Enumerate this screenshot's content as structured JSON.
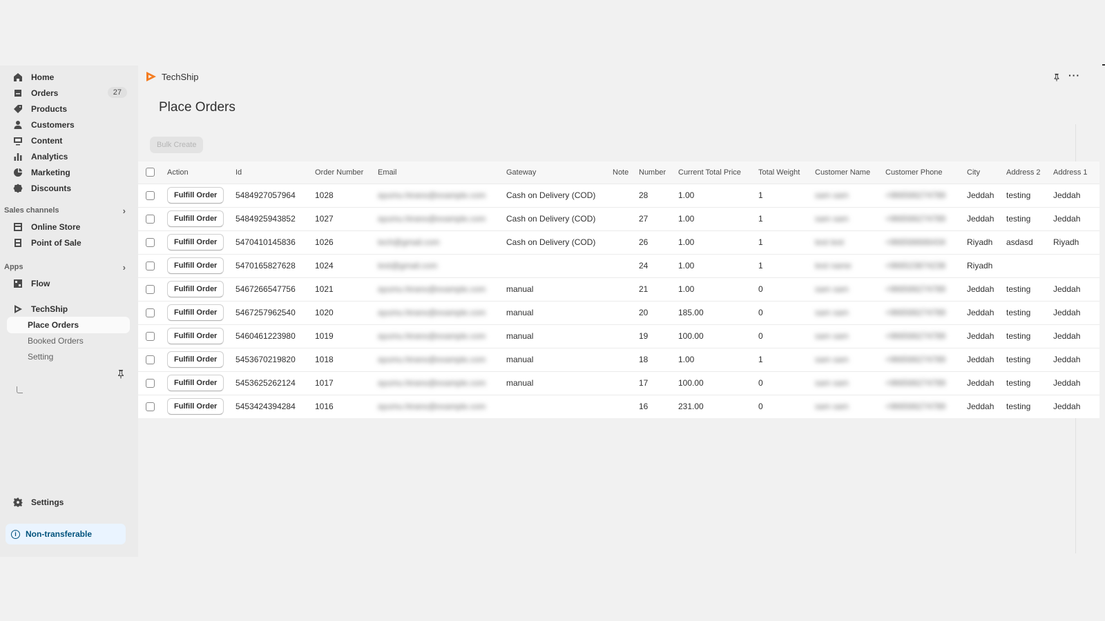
{
  "sidebar": {
    "nav": [
      {
        "label": "Home",
        "icon": "home-icon"
      },
      {
        "label": "Orders",
        "icon": "orders-icon",
        "badge": "27"
      },
      {
        "label": "Products",
        "icon": "tag-icon"
      },
      {
        "label": "Customers",
        "icon": "person-icon"
      },
      {
        "label": "Content",
        "icon": "content-icon"
      },
      {
        "label": "Analytics",
        "icon": "bar-chart-icon"
      },
      {
        "label": "Marketing",
        "icon": "marketing-icon"
      },
      {
        "label": "Discounts",
        "icon": "discount-icon"
      }
    ],
    "sales_channels": {
      "heading": "Sales channels",
      "items": [
        {
          "label": "Online Store",
          "icon": "store-icon"
        },
        {
          "label": "Point of Sale",
          "icon": "pos-icon"
        }
      ]
    },
    "apps": {
      "heading": "Apps",
      "items": [
        {
          "label": "Flow",
          "icon": "flow-icon"
        }
      ]
    },
    "app": {
      "label": "TechShip",
      "sub_items": [
        {
          "label": "Place Orders",
          "active": true
        },
        {
          "label": "Booked Orders"
        },
        {
          "label": "Setting"
        }
      ]
    },
    "settings_label": "Settings",
    "non_transferable_label": "Non-transferable"
  },
  "header": {
    "app_name": "TechShip",
    "more_label": "···"
  },
  "page": {
    "title": "Place Orders",
    "bulk_create_label": "Bulk Create"
  },
  "table": {
    "columns": [
      "Action",
      "Id",
      "Order Number",
      "Email",
      "Gateway",
      "Note",
      "Number",
      "Current Total Price",
      "Total Weight",
      "Customer Name",
      "Customer Phone",
      "City",
      "Address 2",
      "Address 1"
    ],
    "action_label": "Fulfill Order",
    "rows": [
      {
        "id": "5484927057964",
        "order_number": "1028",
        "email": "ayumu.hirano@example.com",
        "gateway": "Cash on Delivery (COD)",
        "note": "",
        "number": "28",
        "price": "1.00",
        "weight": "1",
        "customer": "sam sam",
        "phone": "+966566274789",
        "city": "Jeddah",
        "address2": "testing",
        "address1": "Jeddah"
      },
      {
        "id": "5484925943852",
        "order_number": "1027",
        "email": "ayumu.hirano@example.com",
        "gateway": "Cash on Delivery (COD)",
        "note": "",
        "number": "27",
        "price": "1.00",
        "weight": "1",
        "customer": "sam sam",
        "phone": "+966566274789",
        "city": "Jeddah",
        "address2": "testing",
        "address1": "Jeddah"
      },
      {
        "id": "5470410145836",
        "order_number": "1026",
        "email": "tech@gmail.com",
        "gateway": "Cash on Delivery (COD)",
        "note": "",
        "number": "26",
        "price": "1.00",
        "weight": "1",
        "customer": "test test",
        "phone": "+966566666434",
        "city": "Riyadh",
        "address2": "asdasd",
        "address1": "Riyadh"
      },
      {
        "id": "5470165827628",
        "order_number": "1024",
        "email": "test@gmail.com",
        "gateway": "",
        "note": "",
        "number": "24",
        "price": "1.00",
        "weight": "1",
        "customer": "test name",
        "phone": "+966523874238",
        "city": "Riyadh",
        "address2": "",
        "address1": ""
      },
      {
        "id": "5467266547756",
        "order_number": "1021",
        "email": "ayumu.hirano@example.com",
        "gateway": "manual",
        "note": "",
        "number": "21",
        "price": "1.00",
        "weight": "0",
        "customer": "sam sam",
        "phone": "+966566274789",
        "city": "Jeddah",
        "address2": "testing",
        "address1": "Jeddah"
      },
      {
        "id": "5467257962540",
        "order_number": "1020",
        "email": "ayumu.hirano@example.com",
        "gateway": "manual",
        "note": "",
        "number": "20",
        "price": "185.00",
        "weight": "0",
        "customer": "sam sam",
        "phone": "+966566274789",
        "city": "Jeddah",
        "address2": "testing",
        "address1": "Jeddah"
      },
      {
        "id": "5460461223980",
        "order_number": "1019",
        "email": "ayumu.hirano@example.com",
        "gateway": "manual",
        "note": "",
        "number": "19",
        "price": "100.00",
        "weight": "0",
        "customer": "sam sam",
        "phone": "+966566274789",
        "city": "Jeddah",
        "address2": "testing",
        "address1": "Jeddah"
      },
      {
        "id": "5453670219820",
        "order_number": "1018",
        "email": "ayumu.hirano@example.com",
        "gateway": "manual",
        "note": "",
        "number": "18",
        "price": "1.00",
        "weight": "1",
        "customer": "sam sam",
        "phone": "+966566274789",
        "city": "Jeddah",
        "address2": "testing",
        "address1": "Jeddah"
      },
      {
        "id": "5453625262124",
        "order_number": "1017",
        "email": "ayumu.hirano@example.com",
        "gateway": "manual",
        "note": "",
        "number": "17",
        "price": "100.00",
        "weight": "0",
        "customer": "sam sam",
        "phone": "+966566274789",
        "city": "Jeddah",
        "address2": "testing",
        "address1": "Jeddah"
      },
      {
        "id": "5453424394284",
        "order_number": "1016",
        "email": "ayumu.hirano@example.com",
        "gateway": "",
        "note": "",
        "number": "16",
        "price": "231.00",
        "weight": "0",
        "customer": "sam sam",
        "phone": "+966566274789",
        "city": "Jeddah",
        "address2": "testing",
        "address1": "Jeddah"
      }
    ]
  },
  "colors": {
    "accent_logo": "#f47c20",
    "info_bg": "#eaf4ff",
    "info_text": "#00527c"
  }
}
